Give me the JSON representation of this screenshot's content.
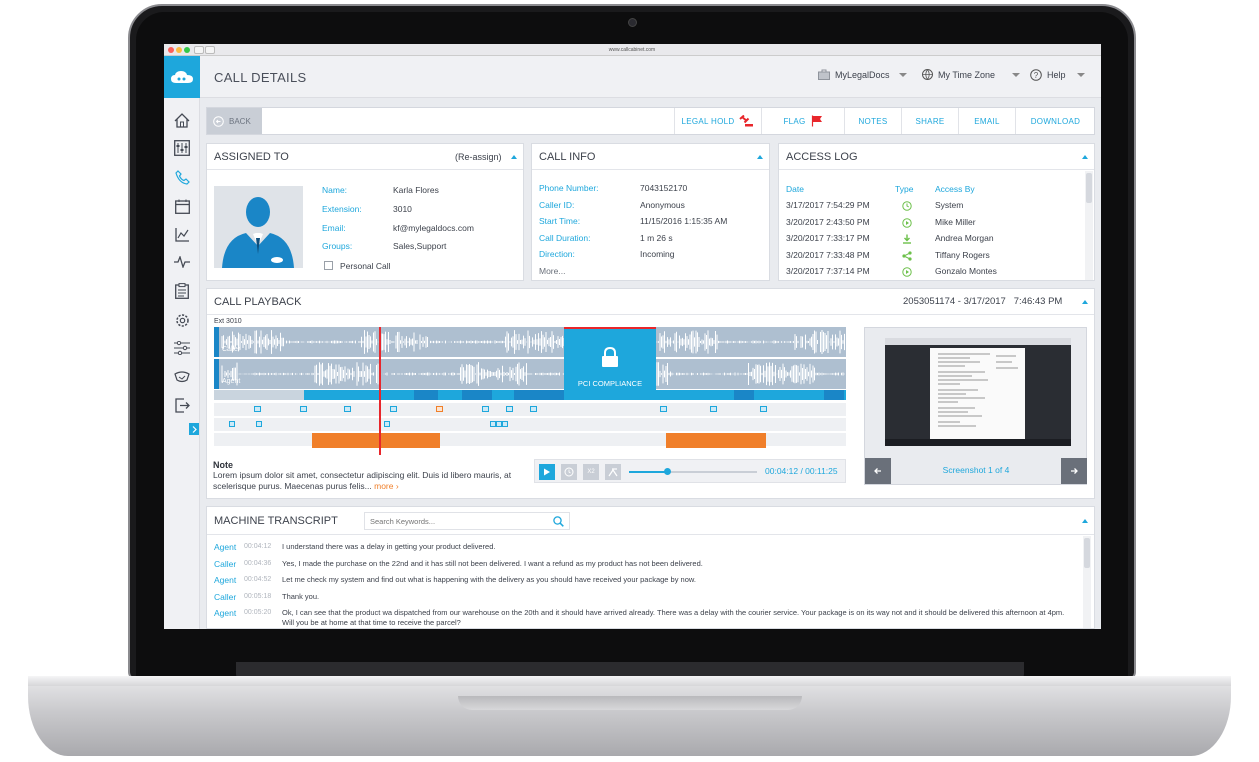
{
  "browser": {
    "url": "www.callcabinet.com"
  },
  "header": {
    "title": "CALL DETAILS",
    "menu": [
      {
        "label": "MyLegalDocs",
        "icon": "briefcase-icon"
      },
      {
        "label": "My Time Zone",
        "icon": "globe-icon"
      },
      {
        "label": "Help",
        "icon": "question-icon"
      }
    ]
  },
  "toolbar": {
    "back_label": "BACK",
    "legal_hold_label": "LEGAL HOLD",
    "flag_label": "FLAG",
    "notes_label": "NOTES",
    "share_label": "SHARE",
    "email_label": "EMAIL",
    "download_label": "DOWNLOAD"
  },
  "assigned": {
    "title": "ASSIGNED TO",
    "reassign": "(Re-assign)",
    "rows": [
      {
        "label": "Name:",
        "value": "Karla Flores"
      },
      {
        "label": "Extension:",
        "value": "3010"
      },
      {
        "label": "Email:",
        "value": "kf@mylegaldocs.com"
      },
      {
        "label": "Groups:",
        "value": "Sales,Support"
      }
    ],
    "personal_call": "Personal Call"
  },
  "callinfo": {
    "title": "CALL INFO",
    "rows": [
      {
        "label": "Phone Number:",
        "value": "7043152170"
      },
      {
        "label": "Caller ID:",
        "value": "Anonymous"
      },
      {
        "label": "Start Time:",
        "value": "11/15/2016 1:15:35 AM"
      },
      {
        "label": "Call Duration:",
        "value": "1 m 26 s"
      },
      {
        "label": "Direction:",
        "value": "Incoming"
      }
    ],
    "more": "More..."
  },
  "accesslog": {
    "title": "ACCESS LOG",
    "headers": {
      "date": "Date",
      "type": "Type",
      "by": "Access By"
    },
    "rows": [
      {
        "date": "3/17/2017 7:54:29 PM",
        "icon": "clock-icon",
        "color": "#6cc04a",
        "by": "System"
      },
      {
        "date": "3/20/2017 2:43:50 PM",
        "icon": "play-icon",
        "color": "#6cc04a",
        "by": "Mike Miller"
      },
      {
        "date": "3/20/2017 7:33:17 PM",
        "icon": "download-icon",
        "color": "#6cc04a",
        "by": "Andrea Morgan"
      },
      {
        "date": "3/20/2017 7:33:48 PM",
        "icon": "share-icon",
        "color": "#6cc04a",
        "by": "Tiffany Rogers"
      },
      {
        "date": "3/20/2017 7:37:14 PM",
        "icon": "play-icon",
        "color": "#6cc04a",
        "by": "Gonzalo Montes"
      }
    ]
  },
  "playback": {
    "title": "CALL PLAYBACK",
    "meta": "2053051174 - 3/17/2017   7:46:43 PM",
    "ext": "Ext 3010",
    "caller_label": "Caller",
    "agent_label": "Agent",
    "pci_label": "PCI COMPLIANCE",
    "note_title": "Note",
    "note_text": "Lorem ipsum dolor sit amet, consectetur adipiscing elit. Duis id libero mauris, at scelerisque purus. Maecenas purus felis...",
    "note_more": "more ›",
    "speed_label": "X2",
    "progress": 0.3,
    "time": "00:04:12 / 00:11:25",
    "screenshot_prefix": "Screenshot",
    "screenshot_count": "1 of 4"
  },
  "transcript": {
    "title": "MACHINE TRANSCRIPT",
    "search_placeholder": "Search Keywords...",
    "lines": [
      {
        "speaker": "Agent",
        "time": "00:04:12",
        "text": "I understand there was a delay in getting your product delivered."
      },
      {
        "speaker": "Caller",
        "time": "00:04:36",
        "text": "Yes, I made the purchase on the 22nd and it has still not been delivered. I want a refund as my product has not been delivered."
      },
      {
        "speaker": "Agent",
        "time": "00:04:52",
        "text": "Let me check my system and find out what is happening with the delivery as you should have received your package by now."
      },
      {
        "speaker": "Caller",
        "time": "00:05:18",
        "text": "Thank you."
      },
      {
        "speaker": "Agent",
        "time": "00:05:20",
        "text": "Ok, I can see that the product wa dispatched from our warehouse on the 20th and it should have arrived already. There was a delay with the courier service. Your package is on its way not and it should be delivered this afternoon at 4pm. Will you be at home at that time to receive the parcel?"
      }
    ]
  },
  "colors": {
    "accent": "#1ea7dc",
    "flag": "#e8262b",
    "orange": "#f07f2a"
  }
}
